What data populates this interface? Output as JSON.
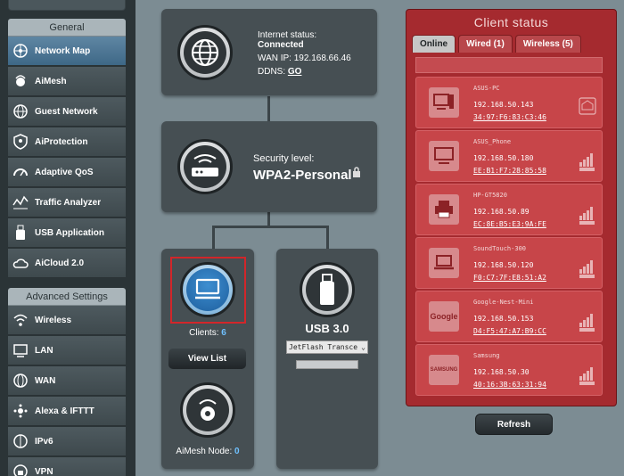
{
  "sidebar": {
    "general_header": "General",
    "general_items": [
      {
        "label": "Network Map",
        "icon": "network-map-icon",
        "active": true
      },
      {
        "label": "AiMesh",
        "icon": "aimesh-icon"
      },
      {
        "label": "Guest Network",
        "icon": "guest-network-icon"
      },
      {
        "label": "AiProtection",
        "icon": "aiprotection-icon"
      },
      {
        "label": "Adaptive QoS",
        "icon": "qos-icon"
      },
      {
        "label": "Traffic Analyzer",
        "icon": "traffic-analyzer-icon"
      },
      {
        "label": "USB Application",
        "icon": "usb-icon"
      },
      {
        "label": "AiCloud 2.0",
        "icon": "cloud-icon"
      }
    ],
    "advanced_header": "Advanced Settings",
    "advanced_items": [
      {
        "label": "Wireless",
        "icon": "wireless-icon"
      },
      {
        "label": "LAN",
        "icon": "lan-icon"
      },
      {
        "label": "WAN",
        "icon": "wan-icon"
      },
      {
        "label": "Alexa & IFTTT",
        "icon": "alexa-icon"
      },
      {
        "label": "IPv6",
        "icon": "ipv6-icon"
      },
      {
        "label": "VPN",
        "icon": "vpn-icon"
      }
    ]
  },
  "internet": {
    "status_label": "Internet status:",
    "status_value": "Connected",
    "wan_ip": "WAN IP: 192.168.66.46",
    "ddns_label": "DDNS:",
    "ddns_link": "GO"
  },
  "security": {
    "label": "Security level:",
    "value": "WPA2-Personal"
  },
  "clients": {
    "label": "Clients:",
    "count": "6",
    "view_list": "View List"
  },
  "aimesh": {
    "label": "AiMesh Node:",
    "count": "0"
  },
  "usb": {
    "title": "USB 3.0",
    "device": "JetFlash Transce"
  },
  "client_status": {
    "title": "Client status",
    "tabs": [
      "Online",
      "Wired (1)",
      "Wireless (5)"
    ],
    "clients": [
      {
        "name": "ASUS-PC",
        "ip": "192.168.50.143",
        "mac": "34:97:F6:83:C3:46",
        "type": "pc",
        "conn": "wired"
      },
      {
        "name": "ASUS_Phone",
        "ip": "192.168.50.180",
        "mac": "EE:B1:F7:28:85:58",
        "type": "monitor",
        "conn": "5G"
      },
      {
        "name": "HP-GT5820",
        "ip": "192.168.50.89",
        "mac": "EC:8E:B5:E3:9A:FE",
        "type": "printer",
        "conn": "2.4G"
      },
      {
        "name": "SoundTouch-300",
        "ip": "192.168.50.120",
        "mac": "F0:C7:7F:E8:51:A2",
        "type": "laptop",
        "conn": "2.4G"
      },
      {
        "name": "Google-Nest-Mini",
        "ip": "192.168.50.153",
        "mac": "D4:F5:47:A7:B9:CC",
        "type": "google",
        "conn": "5G"
      },
      {
        "name": "Samsung",
        "ip": "192.168.50.30",
        "mac": "40:16:3B:63:31:94",
        "type": "samsung",
        "conn": "5G"
      }
    ],
    "refresh": "Refresh"
  },
  "icon_labels": {
    "google": "Google",
    "samsung": "SAMSUNG"
  }
}
